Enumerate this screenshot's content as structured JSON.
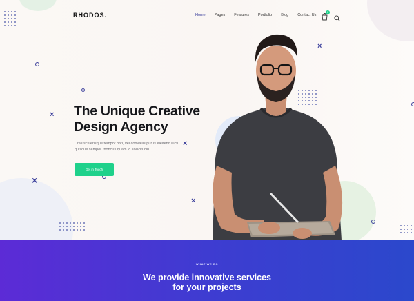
{
  "brand": {
    "logo": "RHODOS."
  },
  "nav": {
    "items": [
      {
        "label": "Home",
        "active": true
      },
      {
        "label": "Pages"
      },
      {
        "label": "Features"
      },
      {
        "label": "Portfolio"
      },
      {
        "label": "Blog"
      },
      {
        "label": "Contact Us"
      }
    ],
    "cart_count": "0"
  },
  "hero": {
    "title_line1": "The Unique Creative",
    "title_line2": "Design Agency",
    "description_line1": "Cras scelerisque tempor orci, vel convallis purus eleifend luctu",
    "description_line2": "quisque semper rhoncus quam id sollicitudin.",
    "cta_label": "Get in Touch"
  },
  "services": {
    "eyebrow": "WHAT WE DO",
    "title_line1": "We provide innovative services",
    "title_line2": "for your projects"
  },
  "colors": {
    "accent": "#3b3f9b",
    "cta": "#1fd18b",
    "band_start": "#5c2bd6",
    "band_end": "#2b48cc"
  },
  "icons": [
    "cart-icon",
    "search-icon"
  ]
}
